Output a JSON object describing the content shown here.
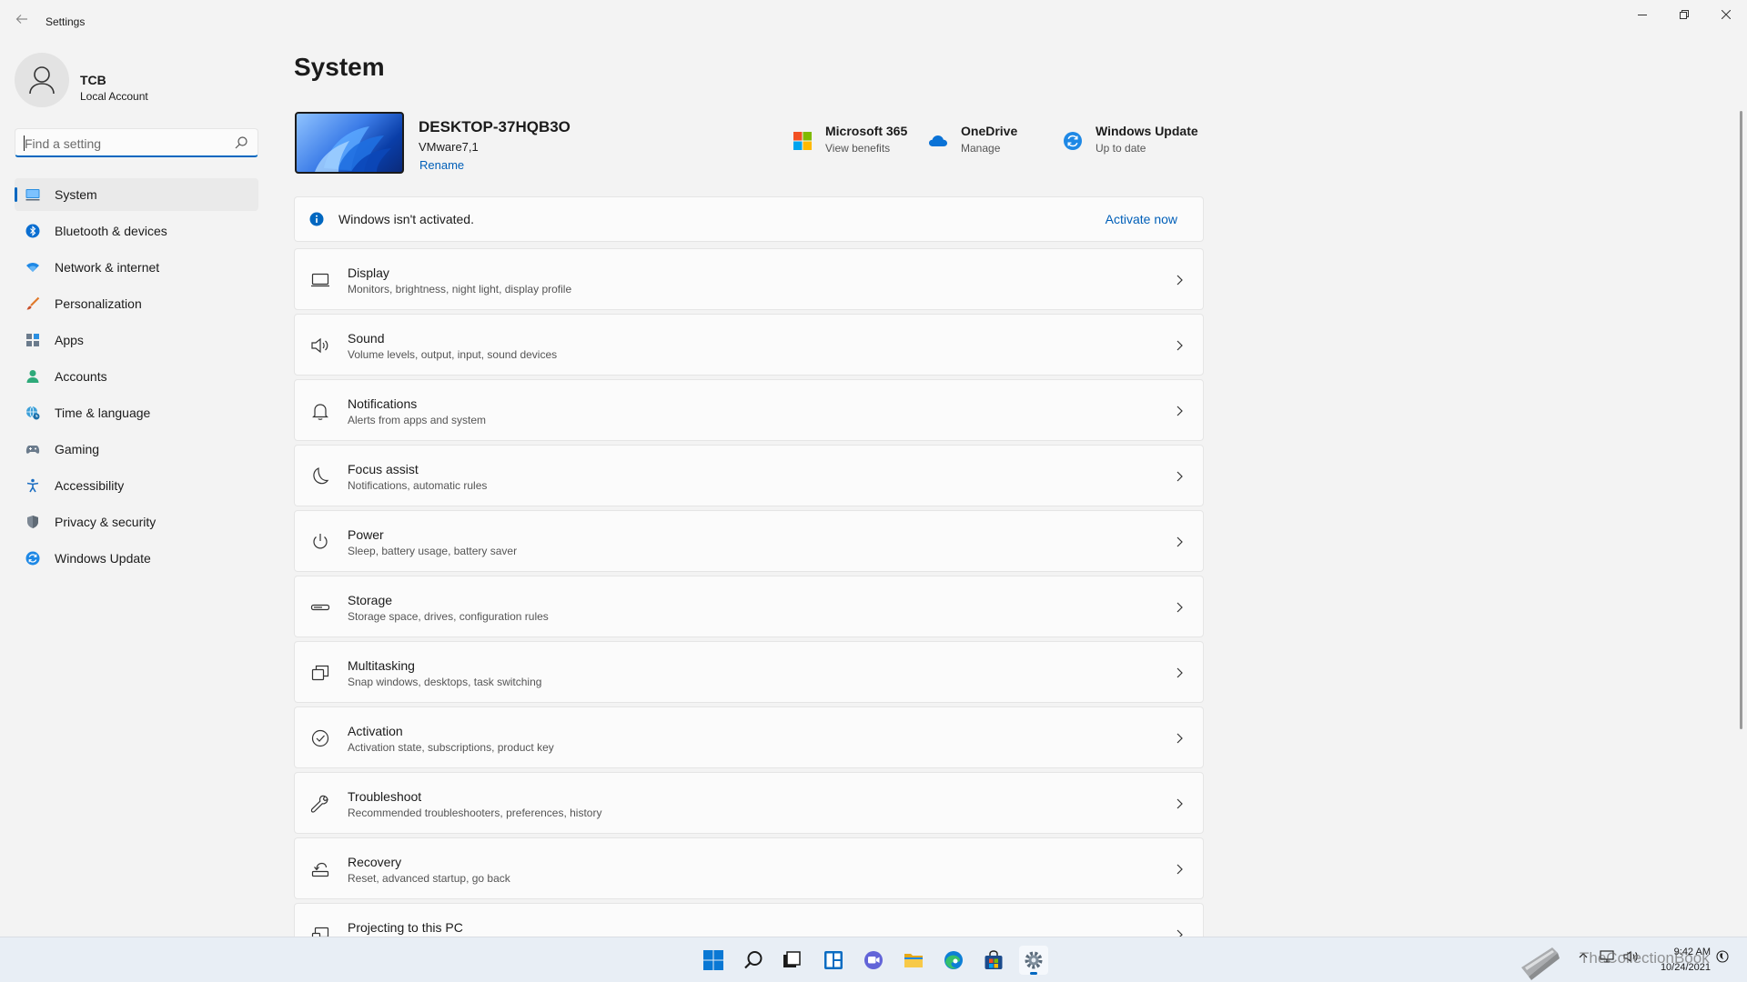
{
  "window": {
    "title": "Settings",
    "back_icon": "back-arrow-icon"
  },
  "profile": {
    "name": "TCB",
    "account_type": "Local Account"
  },
  "search": {
    "placeholder": "Find a setting"
  },
  "sidebar": {
    "items": [
      {
        "label": "System",
        "icon": "monitor-icon",
        "selected": true
      },
      {
        "label": "Bluetooth & devices",
        "icon": "bluetooth-icon"
      },
      {
        "label": "Network & internet",
        "icon": "wifi-icon"
      },
      {
        "label": "Personalization",
        "icon": "brush-icon"
      },
      {
        "label": "Apps",
        "icon": "apps-icon"
      },
      {
        "label": "Accounts",
        "icon": "person-icon"
      },
      {
        "label": "Time & language",
        "icon": "globe-clock-icon"
      },
      {
        "label": "Gaming",
        "icon": "gamepad-icon"
      },
      {
        "label": "Accessibility",
        "icon": "accessibility-icon"
      },
      {
        "label": "Privacy & security",
        "icon": "shield-icon"
      },
      {
        "label": "Windows Update",
        "icon": "update-icon"
      }
    ]
  },
  "main": {
    "title": "System",
    "device": {
      "name": "DESKTOP-37HQB3O",
      "model": "VMware7,1",
      "rename_label": "Rename"
    },
    "quick_links": [
      {
        "title": "Microsoft 365",
        "subtitle": "View benefits",
        "icon": "microsoft-logo-icon"
      },
      {
        "title": "OneDrive",
        "subtitle": "Manage",
        "icon": "cloud-icon"
      },
      {
        "title": "Windows Update",
        "subtitle": "Up to date",
        "icon": "update-icon"
      }
    ],
    "activation": {
      "message": "Windows isn't activated.",
      "action_label": "Activate now"
    },
    "settings": [
      {
        "title": "Display",
        "subtitle": "Monitors, brightness, night light, display profile",
        "icon": "display-icon"
      },
      {
        "title": "Sound",
        "subtitle": "Volume levels, output, input, sound devices",
        "icon": "speaker-icon"
      },
      {
        "title": "Notifications",
        "subtitle": "Alerts from apps and system",
        "icon": "bell-icon"
      },
      {
        "title": "Focus assist",
        "subtitle": "Notifications, automatic rules",
        "icon": "moon-icon"
      },
      {
        "title": "Power",
        "subtitle": "Sleep, battery usage, battery saver",
        "icon": "power-icon"
      },
      {
        "title": "Storage",
        "subtitle": "Storage space, drives, configuration rules",
        "icon": "drive-icon"
      },
      {
        "title": "Multitasking",
        "subtitle": "Snap windows, desktops, task switching",
        "icon": "multitask-icon"
      },
      {
        "title": "Activation",
        "subtitle": "Activation state, subscriptions, product key",
        "icon": "check-circle-icon"
      },
      {
        "title": "Troubleshoot",
        "subtitle": "Recommended troubleshooters, preferences, history",
        "icon": "wrench-icon"
      },
      {
        "title": "Recovery",
        "subtitle": "Reset, advanced startup, go back",
        "icon": "recovery-icon"
      },
      {
        "title": "Projecting to this PC",
        "subtitle": "",
        "icon": "projection-icon"
      }
    ]
  },
  "taskbar": {
    "apps": [
      "start-icon",
      "search-icon",
      "task-view-icon",
      "widgets-icon",
      "chat-icon",
      "file-explorer-icon",
      "edge-icon",
      "store-icon",
      "settings-icon"
    ],
    "time": "9:42 AM",
    "date": "10/24/2021"
  },
  "watermark": {
    "text": "TheCollectionBook"
  },
  "colors": {
    "accent": "#0067c0",
    "link": "#005fb8",
    "background": "#f3f3f3",
    "card": "#fbfbfb"
  }
}
